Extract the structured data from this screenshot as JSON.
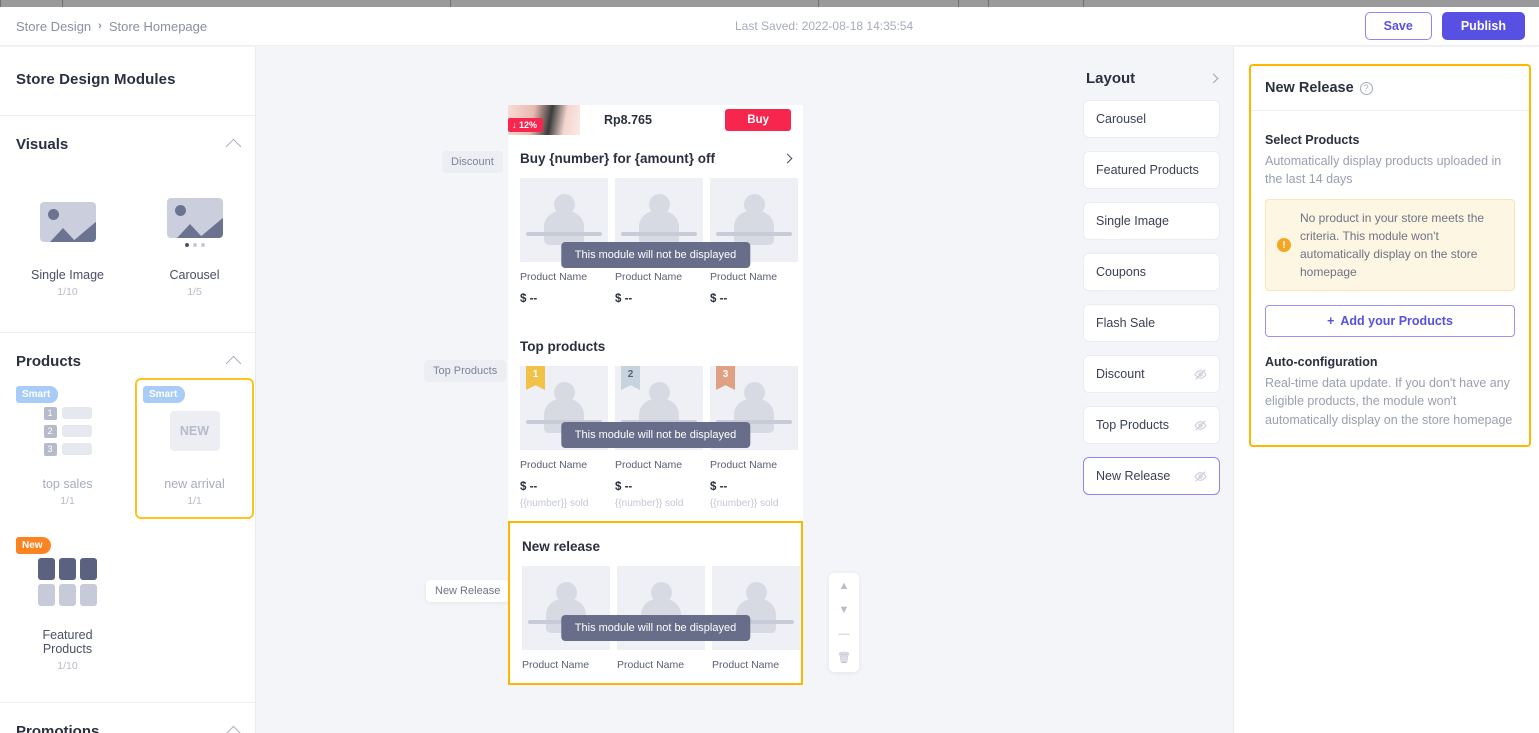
{
  "header": {
    "breadcrumb_root": "Store Design",
    "breadcrumb_sep": "›",
    "breadcrumb_current": "Store Homepage",
    "last_saved": "Last Saved: 2022-08-18 14:35:54",
    "save_label": "Save",
    "publish_label": "Publish"
  },
  "sidebar": {
    "title": "Store Design Modules",
    "sections": [
      {
        "title": "Visuals",
        "cards": [
          {
            "label": "Single Image",
            "count": "1/10",
            "tag": "",
            "icon": "single-image-icon"
          },
          {
            "label": "Carousel",
            "count": "1/5",
            "tag": "",
            "icon": "carousel-icon"
          }
        ]
      },
      {
        "title": "Products",
        "cards": [
          {
            "label": "top sales",
            "count": "1/1",
            "tag": "Smart",
            "icon": "top-sales-icon"
          },
          {
            "label": "new arrival",
            "count": "1/1",
            "tag": "Smart",
            "icon": "new-arrival-icon"
          },
          {
            "label": "Featured Products",
            "count": "1/10",
            "tag": "New",
            "icon": "featured-products-icon"
          }
        ]
      },
      {
        "title": "Promotions",
        "cards": []
      }
    ]
  },
  "canvas": {
    "module_labels": {
      "discount": "Discount",
      "top_products": "Top Products",
      "new_release": "New Release"
    },
    "strip": {
      "discount_badge": "12%",
      "price": "Rp8.765",
      "buy_label": "Buy"
    },
    "overlay_text": "This module will not be displayed",
    "modules": [
      {
        "title": "Buy {number} for {amount} off",
        "products": [
          {
            "name": "Product Name",
            "price": "$ --",
            "sold": "",
            "rank": ""
          },
          {
            "name": "Product Name",
            "price": "$ --",
            "sold": "",
            "rank": ""
          },
          {
            "name": "Product Name",
            "price": "$ --",
            "sold": "",
            "rank": ""
          }
        ]
      },
      {
        "title": "Top products",
        "products": [
          {
            "name": "Product Name",
            "price": "$ --",
            "sold": "{{number}} sold",
            "rank": "1"
          },
          {
            "name": "Product Name",
            "price": "$ --",
            "sold": "{{number}} sold",
            "rank": "2"
          },
          {
            "name": "Product Name",
            "price": "$ --",
            "sold": "{{number}} sold",
            "rank": "3"
          }
        ]
      },
      {
        "title": "New release",
        "products": [
          {
            "name": "Product Name",
            "price": "",
            "sold": "",
            "rank": ""
          },
          {
            "name": "Product Name",
            "price": "",
            "sold": "",
            "rank": ""
          },
          {
            "name": "Product Name",
            "price": "",
            "sold": "",
            "rank": ""
          }
        ]
      }
    ],
    "tools": [
      "move-up-icon",
      "move-down-icon",
      "collapse-icon",
      "delete-icon"
    ]
  },
  "layout": {
    "title": "Layout",
    "items": [
      {
        "label": "Carousel",
        "hidden": false,
        "active": false
      },
      {
        "label": "Featured Products",
        "hidden": false,
        "active": false
      },
      {
        "label": "Single Image",
        "hidden": false,
        "active": false
      },
      {
        "label": "Coupons",
        "hidden": false,
        "active": false
      },
      {
        "label": "Flash Sale",
        "hidden": false,
        "active": false
      },
      {
        "label": "Discount",
        "hidden": true,
        "active": false
      },
      {
        "label": "Top Products",
        "hidden": true,
        "active": false
      },
      {
        "label": "New Release",
        "hidden": true,
        "active": true
      }
    ]
  },
  "settings": {
    "title": "New Release",
    "help_icon": "?",
    "select_products_label": "Select Products",
    "select_products_desc": "Automatically display products uploaded in the last 14 days",
    "warning_text": "No product in your store meets the criteria. This module won't automatically display on the store homepage",
    "add_products_label": "Add your Products",
    "auto_config_label": "Auto-configuration",
    "auto_config_desc": "Real-time data update. If you don't have any eligible products, the module won't automatically display on the store homepage"
  },
  "colors": {
    "brand": "#5750e3",
    "accent_yellow": "#ffb600",
    "buy_red": "#f7264f",
    "smart_tag": "#a8ccf8",
    "new_tag": "#fb8321"
  }
}
